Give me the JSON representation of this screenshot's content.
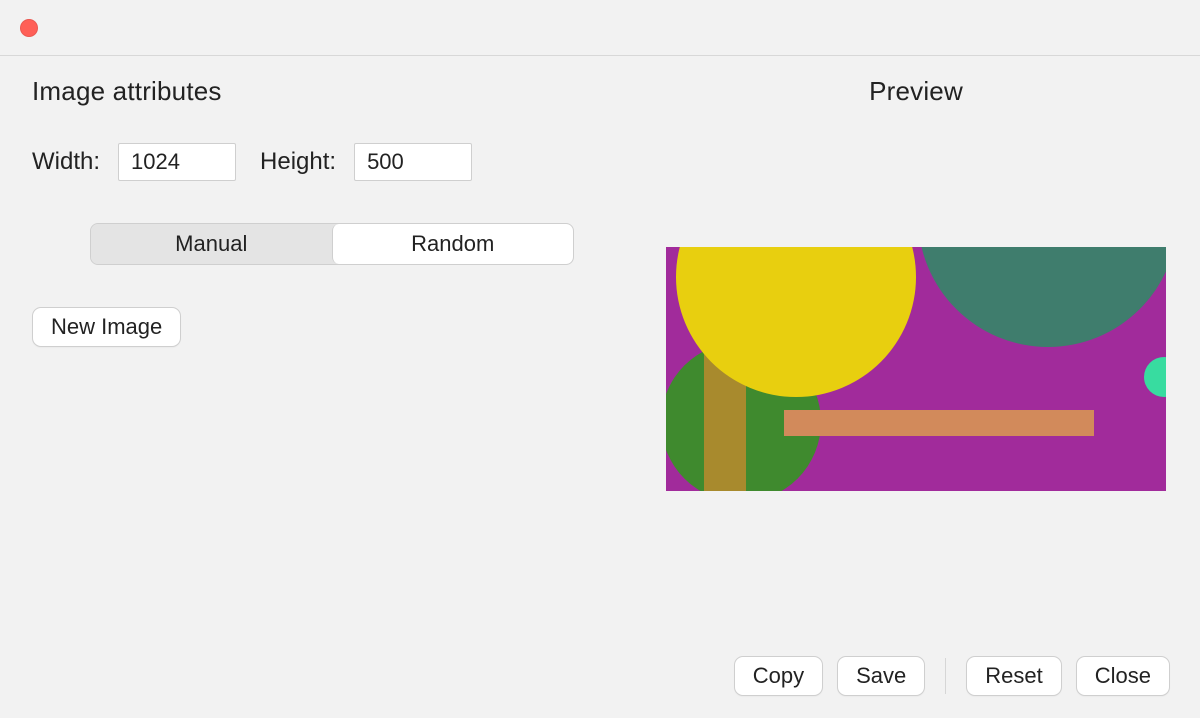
{
  "titles": {
    "attributes": "Image attributes",
    "preview": "Preview"
  },
  "dimensions": {
    "width_label": "Width:",
    "width_value": "1024",
    "height_label": "Height:",
    "height_value": "500"
  },
  "mode": {
    "manual": "Manual",
    "random": "Random",
    "selected": "manual"
  },
  "buttons": {
    "new_image": "New Image",
    "copy": "Copy",
    "save": "Save",
    "reset": "Reset",
    "close": "Close"
  },
  "preview_shapes": {
    "background": "#a12b9b",
    "items": [
      {
        "type": "circle",
        "color": "#e8cf0f"
      },
      {
        "type": "circle",
        "color": "#3f7d6d"
      },
      {
        "type": "circle",
        "color": "#3f8a2e"
      },
      {
        "type": "circle",
        "color": "#38dca0"
      },
      {
        "type": "rect",
        "color": "#d28a5b"
      },
      {
        "type": "rect",
        "color": "#a88a2d"
      }
    ]
  }
}
